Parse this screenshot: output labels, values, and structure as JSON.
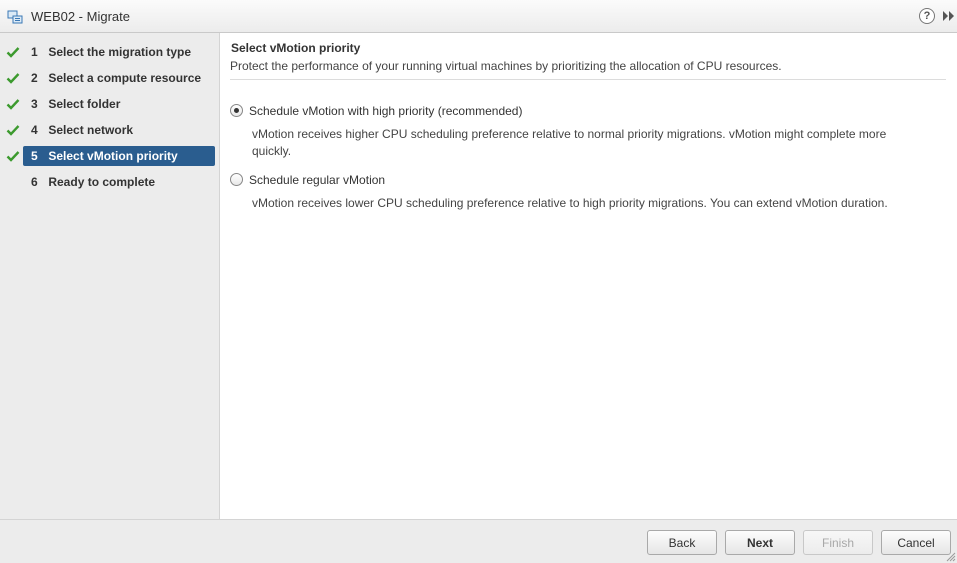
{
  "window": {
    "title": "WEB02 - Migrate",
    "help_glyph": "?",
    "icons": {
      "app": "vm-migrate-icon",
      "help": "help-icon",
      "expand": "expand-icon"
    }
  },
  "steps": [
    {
      "num": "1",
      "label": "Select the migration type",
      "completed": true,
      "active": false
    },
    {
      "num": "2",
      "label": "Select a compute resource",
      "completed": true,
      "active": false
    },
    {
      "num": "3",
      "label": "Select folder",
      "completed": true,
      "active": false
    },
    {
      "num": "4",
      "label": "Select network",
      "completed": true,
      "active": false
    },
    {
      "num": "5",
      "label": "Select vMotion priority",
      "completed": true,
      "active": true
    },
    {
      "num": "6",
      "label": "Ready to complete",
      "completed": false,
      "active": false
    }
  ],
  "main": {
    "title": "Select vMotion priority",
    "description": "Protect the performance of your running virtual machines by prioritizing the allocation of CPU resources.",
    "options": [
      {
        "label": "Schedule vMotion with high priority (recommended)",
        "desc_line1": "vMotion receives higher CPU scheduling preference relative to normal priority migrations. vMotion might complete more",
        "desc_line2": "quickly.",
        "selected": true
      },
      {
        "label": "Schedule regular vMotion",
        "desc_line1": "vMotion receives lower CPU scheduling preference relative to high priority migrations. You can extend vMotion duration.",
        "selected": false
      }
    ]
  },
  "footer": {
    "back_label": "Back",
    "next_label": "Next",
    "finish_label": "Finish",
    "cancel_label": "Cancel"
  },
  "colors": {
    "active_step": "#2a5d8f",
    "check": "#3c9a2e"
  }
}
